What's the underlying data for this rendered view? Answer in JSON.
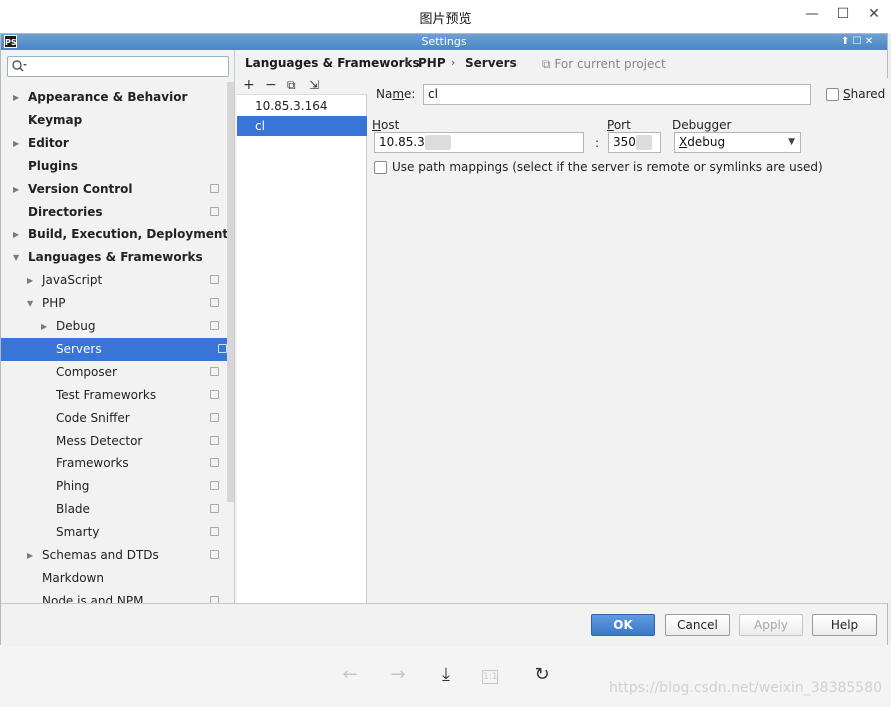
{
  "viewer": {
    "title": "图片预览",
    "minimize": "—",
    "maximize": "☐",
    "close": "✕",
    "toolbar": {
      "prev": "←",
      "next": "→",
      "download": "⤓",
      "actual_size": "1:1",
      "rotate": "↻"
    },
    "watermark": "https://blog.csdn.net/weixin_38385580"
  },
  "dialog": {
    "title": "Settings",
    "logo": "PS",
    "controls": "⬆ ☐ ✕"
  },
  "tree": {
    "search": {
      "value": "",
      "placeholder": ""
    },
    "items": [
      {
        "label": "Appearance & Behavior",
        "bold": true,
        "arrow": "▶",
        "depth": 0,
        "project": false
      },
      {
        "label": "Keymap",
        "bold": true,
        "arrow": "",
        "depth": 0,
        "project": false
      },
      {
        "label": "Editor",
        "bold": true,
        "arrow": "▶",
        "depth": 0,
        "project": false
      },
      {
        "label": "Plugins",
        "bold": true,
        "arrow": "",
        "depth": 0,
        "project": false
      },
      {
        "label": "Version Control",
        "bold": true,
        "arrow": "▶",
        "depth": 0,
        "project": true
      },
      {
        "label": "Directories",
        "bold": true,
        "arrow": "",
        "depth": 0,
        "project": true
      },
      {
        "label": "Build, Execution, Deployment",
        "bold": true,
        "arrow": "▶",
        "depth": 0,
        "project": false
      },
      {
        "label": "Languages & Frameworks",
        "bold": true,
        "arrow": "▼",
        "depth": 0,
        "project": false
      },
      {
        "label": "JavaScript",
        "bold": false,
        "arrow": "▶",
        "depth": 1,
        "project": true
      },
      {
        "label": "PHP",
        "bold": false,
        "arrow": "▼",
        "depth": 1,
        "project": true
      },
      {
        "label": "Debug",
        "bold": false,
        "arrow": "▶",
        "depth": 2,
        "project": true
      },
      {
        "label": "Servers",
        "bold": false,
        "arrow": "",
        "depth": 2,
        "project": true,
        "selected": true
      },
      {
        "label": "Composer",
        "bold": false,
        "arrow": "",
        "depth": 2,
        "project": true
      },
      {
        "label": "Test Frameworks",
        "bold": false,
        "arrow": "",
        "depth": 2,
        "project": true
      },
      {
        "label": "Code Sniffer",
        "bold": false,
        "arrow": "",
        "depth": 2,
        "project": true
      },
      {
        "label": "Mess Detector",
        "bold": false,
        "arrow": "",
        "depth": 2,
        "project": true
      },
      {
        "label": "Frameworks",
        "bold": false,
        "arrow": "",
        "depth": 2,
        "project": true
      },
      {
        "label": "Phing",
        "bold": false,
        "arrow": "",
        "depth": 2,
        "project": true
      },
      {
        "label": "Blade",
        "bold": false,
        "arrow": "",
        "depth": 2,
        "project": true
      },
      {
        "label": "Smarty",
        "bold": false,
        "arrow": "",
        "depth": 2,
        "project": true
      },
      {
        "label": "Schemas and DTDs",
        "bold": false,
        "arrow": "▶",
        "depth": 1,
        "project": true
      },
      {
        "label": "Markdown",
        "bold": false,
        "arrow": "",
        "depth": 1,
        "project": false
      },
      {
        "label": "Node.js and NPM",
        "bold": false,
        "arrow": "",
        "depth": 1,
        "project": true
      }
    ]
  },
  "breadcrumb": {
    "root": "Languages & Frameworks",
    "sep": "›",
    "php": "PHP",
    "servers": "Servers",
    "scope": "⧉ For current project"
  },
  "servers": {
    "toolbar": {
      "add": "+",
      "remove": "−",
      "copy": "⧉",
      "import": "⇲"
    },
    "list": [
      {
        "name": "10.85.3.164",
        "selected": false
      },
      {
        "name": "cl",
        "selected": true
      }
    ]
  },
  "form": {
    "name_label_pre": "Na",
    "name_label_u": "m",
    "name_label_post": "e:",
    "name_value": "cl",
    "shared_label_u": "S",
    "shared_label_post": "hared",
    "host_label_u": "H",
    "host_label_post": "ost",
    "host_value": "10.85.3.",
    "port_label_u": "P",
    "port_label_post": "ort",
    "port_value": "350",
    "colon": ":",
    "debugger_label": "Debugger",
    "debugger_value_u": "X",
    "debugger_value_post": "debug",
    "debugger_arrow": "▼",
    "path_mappings_label": "Use path mappings (select if the server is remote or symlinks are used)"
  },
  "buttons": {
    "ok": "OK",
    "cancel": "Cancel",
    "apply": "Apply",
    "help": "Help"
  }
}
